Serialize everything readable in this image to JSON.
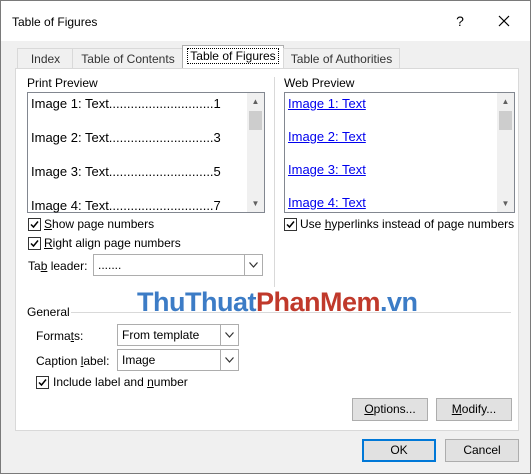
{
  "window": {
    "title": "Table of Figures",
    "help": "?",
    "close": "✕"
  },
  "tabs": [
    {
      "label": "Index"
    },
    {
      "label": "Table of Contents"
    },
    {
      "label": "Table of Figures"
    },
    {
      "label": "Table of Authorities"
    }
  ],
  "print_preview": {
    "label": "Print Preview",
    "lines": [
      "Image 1: Text.............................1",
      "Image 2: Text.............................3",
      "Image 3: Text.............................5",
      "Image 4: Text.............................7"
    ]
  },
  "web_preview": {
    "label": "Web Preview",
    "links": [
      "Image 1: Text",
      "Image 2: Text",
      "Image 3: Text",
      "Image 4: Text"
    ]
  },
  "options": {
    "show_page_numbers": {
      "pre": "",
      "key": "S",
      "post": "how page numbers",
      "checked": true
    },
    "right_align": {
      "pre": "",
      "key": "R",
      "post": "ight align page numbers",
      "checked": true
    },
    "tab_leader": {
      "pre": "Ta",
      "key": "b",
      "post": " leader:",
      "value": "......."
    },
    "use_hyperlinks": {
      "pre": "Use ",
      "key": "h",
      "post": "yperlinks instead of page numbers",
      "checked": true
    }
  },
  "general": {
    "label": "General",
    "formats": {
      "pre": "Forma",
      "key": "t",
      "post": "s:",
      "value": "From template"
    },
    "caption_label": {
      "pre": "Caption ",
      "key": "l",
      "post": "abel:",
      "value": "Image"
    },
    "include_label": {
      "pre": "Include label and ",
      "key": "n",
      "post": "umber",
      "checked": true
    }
  },
  "watermark": {
    "part1": "ThuThuat",
    "part2": "PhanMem",
    "part3": ".vn"
  },
  "buttons": {
    "options": {
      "pre": "",
      "key": "O",
      "post": "ptions..."
    },
    "modify": {
      "pre": "",
      "key": "M",
      "post": "odify..."
    },
    "ok": "OK",
    "cancel": "Cancel"
  }
}
